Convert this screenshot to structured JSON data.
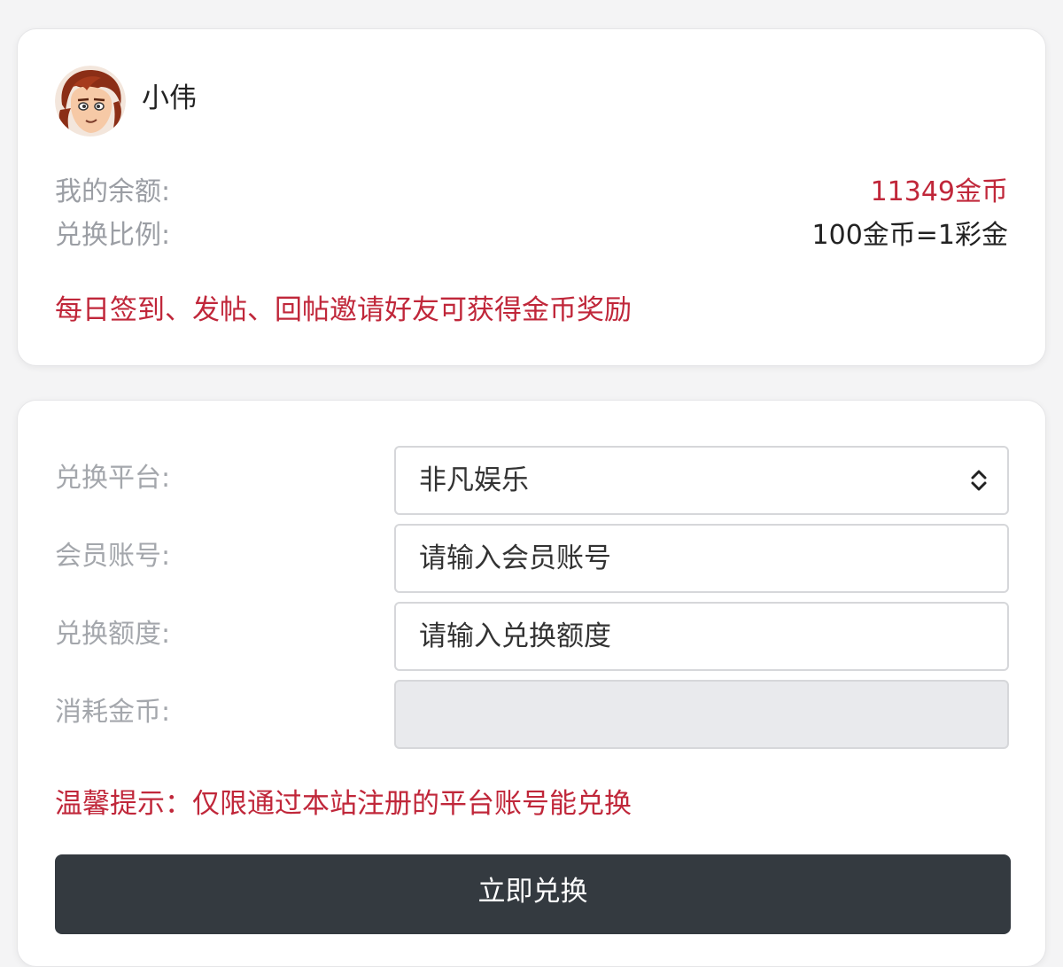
{
  "user": {
    "name": "小伟",
    "balance_label": "我的余额:",
    "balance_value": "11349金币",
    "ratio_label": "兑换比例:",
    "ratio_value": "100金币=1彩金",
    "notice": "每日签到、发帖、回帖邀请好友可获得金币奖励"
  },
  "form": {
    "platform_label": "兑换平台:",
    "platform_selected": "非凡娱乐",
    "account_label": "会员账号:",
    "account_placeholder": "请输入会员账号",
    "amount_label": "兑换额度:",
    "amount_placeholder": "请输入兑换额度",
    "cost_label": "消耗金币:",
    "cost_value": "",
    "tip": "温馨提示：仅限通过本站注册的平台账号能兑换",
    "submit_label": "立即兑换"
  },
  "colors": {
    "accent_red": "#c0273a",
    "button_dark": "#343a40"
  }
}
